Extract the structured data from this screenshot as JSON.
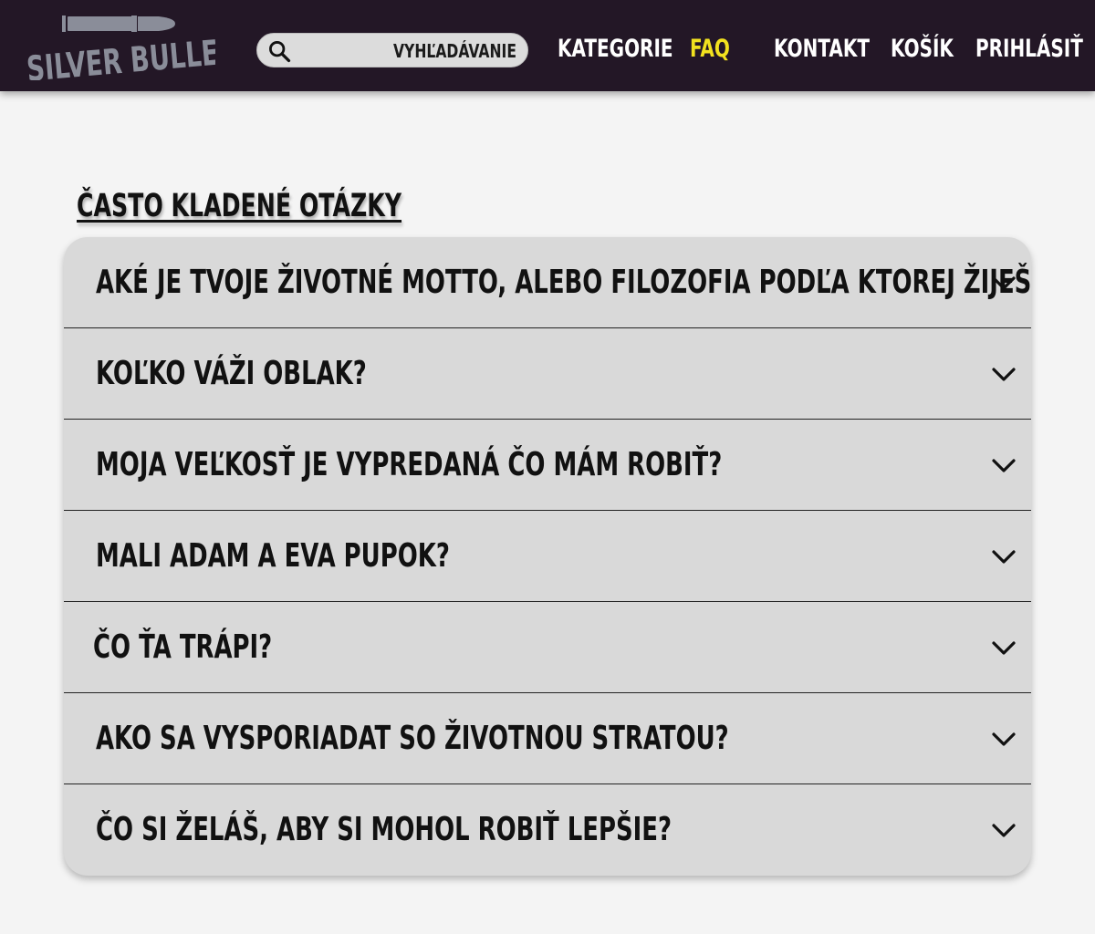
{
  "brand": {
    "logo_text": "SILVER BULLET"
  },
  "search": {
    "placeholder": "VYHĽADÁVANIE",
    "icon": "search-icon"
  },
  "nav": {
    "items": [
      {
        "label": "KATEGORIE",
        "active": false
      },
      {
        "label": "FAQ",
        "active": true
      },
      {
        "label": "KONTAKT",
        "active": false
      },
      {
        "label": "KOŠÍK",
        "active": false
      },
      {
        "label": "PRIHLÁSIŤ",
        "active": false
      }
    ],
    "active_color": "#f2e21f"
  },
  "faq": {
    "title": "ČASTO KLADENÉ OTÁZKY",
    "questions": [
      "AKÉ JE TVOJE ŽIVOTNÉ MOTTO, ALEBO FILOZOFIA PODĽA KTOREJ ŽIJEŠ?",
      "KOĽKO VÁŽI OBLAK?",
      "MOJA VEĽKOSŤ JE VYPREDANÁ ČO MÁM ROBIŤ?",
      "MALI ADAM A EVA PUPOK?",
      "ČO ŤA TRÁPI?",
      "AKO SA VYSPORIADAT SO ŽIVOTNOU STRATOU?",
      "ČO SI ŽELÁŠ, ABY SI MOHOL ROBIŤ LEPŠIE?"
    ],
    "expand_icon": "chevron-down-icon"
  },
  "colors": {
    "navbar_bg": "#231726",
    "page_bg": "#f4f4f4",
    "card_bg": "#d9d9d9",
    "logo_color": "#8a8d99"
  }
}
